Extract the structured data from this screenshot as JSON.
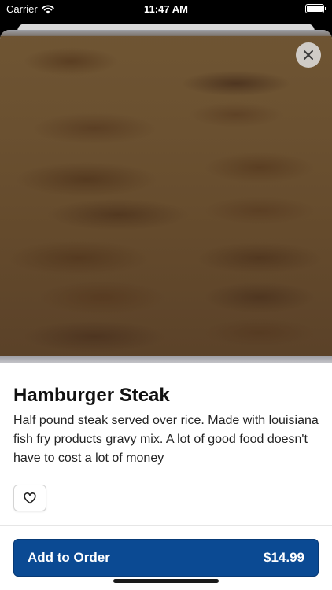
{
  "status_bar": {
    "carrier": "Carrier",
    "time": "11:47 AM",
    "wifi_icon": "wifi-icon",
    "battery_icon": "battery-icon"
  },
  "item": {
    "image_icon": "food-photo",
    "title": "Hamburger Steak",
    "description": "Half pound steak served over rice. Made with louisiana fish fry products gravy mix. A lot of good food doesn't have to cost a lot of money"
  },
  "actions": {
    "close_icon": "close-icon",
    "favorite_icon": "heart-icon",
    "add_to_order_label": "Add to Order",
    "price": "$14.99"
  },
  "colors": {
    "primary": "#0b4a93",
    "text": "#111111"
  }
}
